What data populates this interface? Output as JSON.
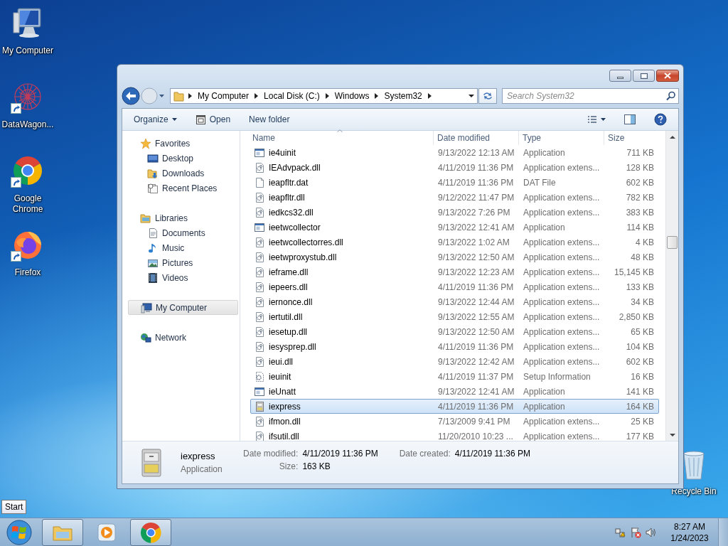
{
  "desktop": {
    "icons": [
      {
        "label": "My Computer",
        "kind": "computer",
        "shortcut": false
      },
      {
        "label": "DataWagon...",
        "kind": "datawagon",
        "shortcut": true
      },
      {
        "label": "Google Chrome",
        "kind": "chrome",
        "shortcut": true
      },
      {
        "label": "Firefox",
        "kind": "firefox",
        "shortcut": true
      }
    ],
    "recycle_bin": {
      "label": "Recycle Bin"
    }
  },
  "window": {
    "address": {
      "crumbs": [
        "My Computer",
        "Local Disk (C:)",
        "Windows",
        "System32"
      ]
    },
    "search": {
      "placeholder": "Search System32"
    },
    "toolbar": {
      "organize": "Organize",
      "open": "Open",
      "new_folder": "New folder"
    },
    "sidebar": [
      {
        "label": "Favorites",
        "kind": "favorites",
        "selected": false,
        "children": [
          {
            "label": "Desktop",
            "kind": "desktop",
            "selected": false
          },
          {
            "label": "Downloads",
            "kind": "downloads",
            "selected": false
          },
          {
            "label": "Recent Places",
            "kind": "recent",
            "selected": false
          }
        ]
      },
      {
        "label": "Libraries",
        "kind": "libraries",
        "selected": false,
        "children": [
          {
            "label": "Documents",
            "kind": "documents",
            "selected": false
          },
          {
            "label": "Music",
            "kind": "music",
            "selected": false
          },
          {
            "label": "Pictures",
            "kind": "pictures",
            "selected": false
          },
          {
            "label": "Videos",
            "kind": "videos",
            "selected": false
          }
        ]
      },
      {
        "label": "My Computer",
        "kind": "computer",
        "selected": true
      },
      {
        "label": "Network",
        "kind": "network",
        "selected": false
      }
    ],
    "columns": [
      {
        "label": "Name",
        "sorted": true
      },
      {
        "label": "Date modified",
        "sorted": false
      },
      {
        "label": "Type",
        "sorted": false
      },
      {
        "label": "Size",
        "sorted": false
      }
    ],
    "rows": [
      {
        "name": "ie4uinit",
        "date": "9/13/2022 12:13 AM",
        "type": "Application",
        "size": "711 KB",
        "kind": "app",
        "selected": false
      },
      {
        "name": "IEAdvpack.dll",
        "date": "4/11/2019 11:36 PM",
        "type": "Application extens...",
        "size": "128 KB",
        "kind": "dll",
        "selected": false
      },
      {
        "name": "ieapfltr.dat",
        "date": "4/11/2019 11:36 PM",
        "type": "DAT File",
        "size": "602 KB",
        "kind": "file",
        "selected": false
      },
      {
        "name": "ieapfltr.dll",
        "date": "9/12/2022 11:47 PM",
        "type": "Application extens...",
        "size": "782 KB",
        "kind": "dll",
        "selected": false
      },
      {
        "name": "iedkcs32.dll",
        "date": "9/13/2022 7:26 PM",
        "type": "Application extens...",
        "size": "383 KB",
        "kind": "dll",
        "selected": false
      },
      {
        "name": "ieetwcollector",
        "date": "9/13/2022 12:41 AM",
        "type": "Application",
        "size": "114 KB",
        "kind": "app",
        "selected": false
      },
      {
        "name": "ieetwcollectorres.dll",
        "date": "9/13/2022 1:02 AM",
        "type": "Application extens...",
        "size": "4 KB",
        "kind": "dll",
        "selected": false
      },
      {
        "name": "ieetwproxystub.dll",
        "date": "9/13/2022 12:50 AM",
        "type": "Application extens...",
        "size": "48 KB",
        "kind": "dll",
        "selected": false
      },
      {
        "name": "ieframe.dll",
        "date": "9/13/2022 12:23 AM",
        "type": "Application extens...",
        "size": "15,145 KB",
        "kind": "dll",
        "selected": false
      },
      {
        "name": "iepeers.dll",
        "date": "4/11/2019 11:36 PM",
        "type": "Application extens...",
        "size": "133 KB",
        "kind": "dll",
        "selected": false
      },
      {
        "name": "iernonce.dll",
        "date": "9/13/2022 12:44 AM",
        "type": "Application extens...",
        "size": "34 KB",
        "kind": "dll",
        "selected": false
      },
      {
        "name": "iertutil.dll",
        "date": "9/13/2022 12:55 AM",
        "type": "Application extens...",
        "size": "2,850 KB",
        "kind": "dll",
        "selected": false
      },
      {
        "name": "iesetup.dll",
        "date": "9/13/2022 12:50 AM",
        "type": "Application extens...",
        "size": "65 KB",
        "kind": "dll",
        "selected": false
      },
      {
        "name": "iesysprep.dll",
        "date": "4/11/2019 11:36 PM",
        "type": "Application extens...",
        "size": "104 KB",
        "kind": "dll",
        "selected": false
      },
      {
        "name": "ieui.dll",
        "date": "9/13/2022 12:42 AM",
        "type": "Application extens...",
        "size": "602 KB",
        "kind": "dll",
        "selected": false
      },
      {
        "name": "ieuinit",
        "date": "4/11/2019 11:37 PM",
        "type": "Setup Information",
        "size": "16 KB",
        "kind": "setup",
        "selected": false
      },
      {
        "name": "ieUnatt",
        "date": "9/13/2022 12:41 AM",
        "type": "Application",
        "size": "141 KB",
        "kind": "app",
        "selected": false
      },
      {
        "name": "iexpress",
        "date": "4/11/2019 11:36 PM",
        "type": "Application",
        "size": "164 KB",
        "kind": "cabinet",
        "selected": true
      },
      {
        "name": "ifmon.dll",
        "date": "7/13/2009 9:41 PM",
        "type": "Application extens...",
        "size": "25 KB",
        "kind": "dll",
        "selected": false
      },
      {
        "name": "ifsutil.dll",
        "date": "11/20/2010 10:23 ...",
        "type": "Application extens...",
        "size": "177 KB",
        "kind": "dll",
        "selected": false
      }
    ],
    "details": {
      "name": "iexpress",
      "type": "Application",
      "kind": "cabinet",
      "fields": [
        {
          "label": "Date modified:",
          "value": "4/11/2019 11:36 PM"
        },
        {
          "label": "Size:",
          "value": "163 KB"
        },
        {
          "label": "Date created:",
          "value": "4/11/2019 11:36 PM"
        }
      ]
    }
  },
  "taskbar": {
    "tooltip": "Start",
    "apps": [
      {
        "kind": "explorer",
        "active": true
      },
      {
        "kind": "media",
        "active": false
      },
      {
        "kind": "chrome",
        "active": true
      }
    ],
    "clock": {
      "time": "8:27 AM",
      "date": "1/24/2023"
    }
  }
}
